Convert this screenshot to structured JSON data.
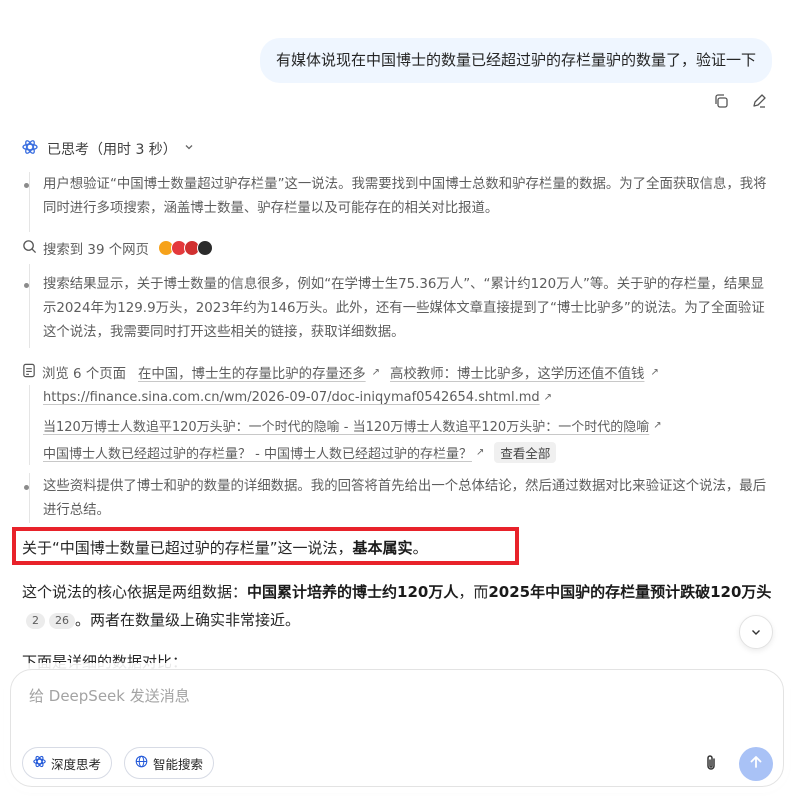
{
  "user_message": "有媒体说现在中国博士的数量已经超过驴的存栏量驴的数量了，验证一下",
  "thinking": {
    "label": "已思考（用时 3 秒）",
    "para1": "用户想验证“中国博士数量超过驴存栏量”这一说法。我需要找到中国博士总数和驴存栏量的数据。为了全面获取信息，我将同时进行多项搜索，涵盖博士数量、驴存栏量以及可能存在的相关对比报道。",
    "search_label": "搜索到 39 个网页",
    "para2": "搜索结果显示，关于博士数量的信息很多，例如“在学博士生75.36万人”、“累计约120万人”等。关于驴的存栏量，结果显示2024年为129.9万头，2023年约为146万头。此外，还有一些媒体文章直接提到了“博士比驴多”的说法。为了全面验证这个说法，我需要同时打开这些相关的链接，获取详细数据。",
    "browse_label": "浏览 6 个页面",
    "links": [
      "在中国，博士生的存量比驴的存量还多",
      "高校教师：博士比驴多，这学历还值不值钱",
      "https://finance.sina.com.cn/wm/2026-09-07/doc-iniqymaf0542654.shtml.md",
      "当120万博士人数追平120万头驴：一个时代的隐喻 - 当120万博士人数追平120万头驴：一个时代的隐喻",
      "中国博士人数已经超过驴的存栏量？ - 中国博士人数已经超过驴的存栏量？"
    ],
    "see_all": "查看全部",
    "para3": "这些资料提供了博士和驴的数量的详细数据。我的回答将首先给出一个总体结论，然后通过数据对比来验证这个说法，最后进行总结。"
  },
  "answer": {
    "line1_prefix": "关于“中国博士数量已超过驴的存栏量”这一说法，",
    "line1_bold": "基本属实",
    "line1_suffix": "。",
    "p2_a": "这个说法的核心依据是两组数据：",
    "p2_b": "中国累计培养的博士约120万人",
    "p2_c": "，而",
    "p2_d": "2025年中国驴的存栏量预计跌破120万头",
    "cite1": "2",
    "cite2": "26",
    "p2_e": "。两者在数量级上确实非常接近。",
    "p3": "下面是详细的数据对比："
  },
  "composer": {
    "placeholder": "给 DeepSeek 发送消息",
    "deep_think": "深度思考",
    "web_search": "智能搜索"
  },
  "colors": {
    "highlight_border": "#e8222a",
    "accent": "#245ad9",
    "send_disabled": "#a9c2f6"
  },
  "favicons": [
    "#f6a21b",
    "#e4393c",
    "#d03030",
    "#2b2b2b"
  ]
}
